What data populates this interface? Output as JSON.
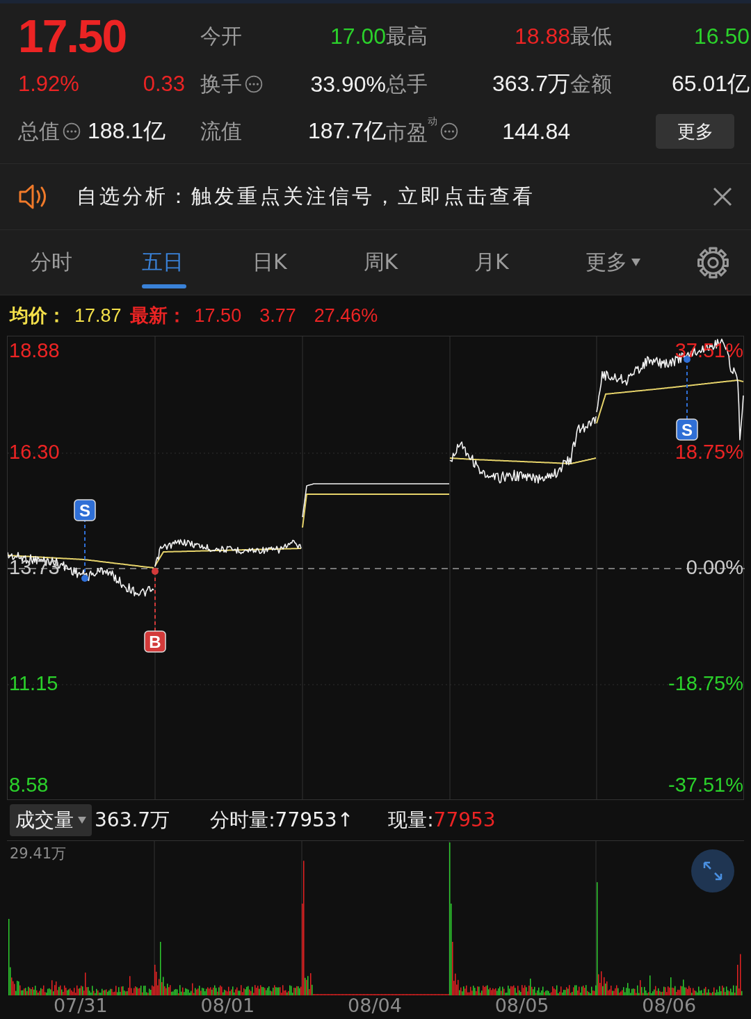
{
  "quote": {
    "price": "17.50",
    "change_pct": "1.92%",
    "change": "0.33",
    "color": "#ec2424"
  },
  "stat_rows": [
    [
      {
        "label": "今开",
        "value": "17.00",
        "color": "#2bd12b",
        "info": false
      },
      {
        "label": "最高",
        "value": "18.88",
        "color": "#ec2424",
        "info": false
      },
      {
        "label": "最低",
        "value": "16.50",
        "color": "#2bd12b",
        "info": false
      }
    ],
    [
      {
        "label": "换手",
        "value": "33.90%",
        "color": "#f2f2f2",
        "info": true
      },
      {
        "label": "总手",
        "value": "363.7万",
        "color": "#f2f2f2",
        "info": false
      },
      {
        "label": "金额",
        "value": "65.01亿",
        "color": "#f2f2f2",
        "info": false
      }
    ],
    [
      {
        "label": "总值",
        "value": "188.1亿",
        "color": "#f2f2f2",
        "info": true
      },
      {
        "label": "流值",
        "value": "187.7亿",
        "color": "#f2f2f2",
        "info": false
      },
      {
        "label": "市盈$^{动}$",
        "value": "144.84",
        "color": "#f2f2f2",
        "info": true
      }
    ]
  ],
  "more_button": "更多",
  "notice": {
    "text": "自选分析：触发重点关注信号，立即点击查看"
  },
  "tabs": [
    {
      "label": "分时",
      "selected": false,
      "dropdown": false
    },
    {
      "label": "五日",
      "selected": true,
      "dropdown": false
    },
    {
      "label": "日K",
      "selected": false,
      "dropdown": false
    },
    {
      "label": "周K",
      "selected": false,
      "dropdown": false
    },
    {
      "label": "月K",
      "selected": false,
      "dropdown": false
    },
    {
      "label": "更多",
      "selected": false,
      "dropdown": true
    }
  ],
  "price_info": {
    "avg_label": "均价：",
    "avg_value": "17.87",
    "latest_label": "最新：",
    "latest_values": [
      "17.50",
      "3.77",
      "27.46%"
    ]
  },
  "price_chart": {
    "left_labels": [
      {
        "text": "18.88",
        "color": "#ec2424"
      },
      {
        "text": "16.30",
        "color": "#ec2424"
      },
      {
        "text": "13.73",
        "color": "#cccccc"
      },
      {
        "text": "11.15",
        "color": "#2bd12b"
      },
      {
        "text": "8.58",
        "color": "#2bd12b"
      }
    ],
    "right_labels": [
      {
        "text": "37.51%",
        "color": "#ec2424"
      },
      {
        "text": "18.75%",
        "color": "#ec2424"
      },
      {
        "text": "0.00%",
        "color": "#cccccc"
      },
      {
        "text": "-18.75%",
        "color": "#2bd12b"
      },
      {
        "text": "-37.51%",
        "color": "#2bd12b"
      }
    ],
    "signals": [
      {
        "label": "S",
        "kind": "sell"
      },
      {
        "label": "B",
        "kind": "buy"
      },
      {
        "label": "S",
        "kind": "sell"
      }
    ]
  },
  "volume_bar": {
    "selector": "成交量",
    "total": "363.7万",
    "items": [
      {
        "label": "分时量:",
        "value": "77953↑",
        "color": "#f2f2f2"
      },
      {
        "label": "现量:",
        "value": "77953",
        "color": "#ec2424"
      }
    ]
  },
  "volume_chart": {
    "max_label": "29.41万",
    "dates": [
      "07/31",
      "08/01",
      "08/04",
      "08/05",
      "08/06"
    ]
  }
}
